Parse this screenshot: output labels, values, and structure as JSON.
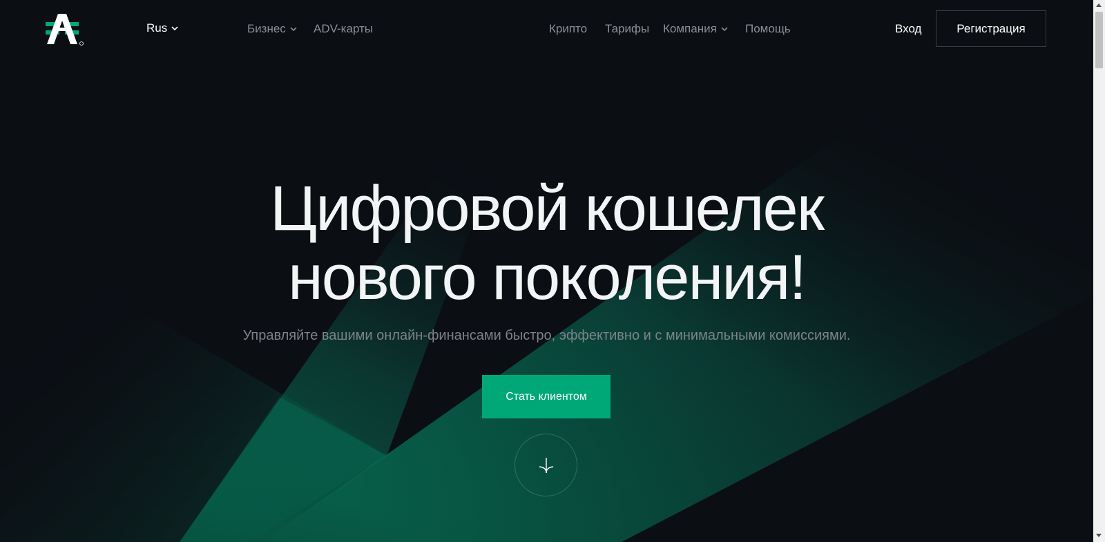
{
  "header": {
    "language": "Rus",
    "nav_left": [
      {
        "label": "Бизнес",
        "has_dropdown": true
      },
      {
        "label": "ADV-карты",
        "has_dropdown": false
      }
    ],
    "nav_right": [
      {
        "label": "Крипто",
        "has_dropdown": false
      },
      {
        "label": "Тарифы",
        "has_dropdown": false
      },
      {
        "label": "Компания",
        "has_dropdown": true
      },
      {
        "label": "Помощь",
        "has_dropdown": false
      }
    ],
    "login_label": "Вход",
    "register_label": "Регистрация"
  },
  "hero": {
    "title_line1": "Цифровой кошелек",
    "title_line2": "нового поколения!",
    "subtitle": "Управляйте вашими онлайн-финансами быстро, эффективно и с минимальными комиссиями.",
    "cta_label": "Стать клиентом"
  },
  "icons": {
    "logo": "advcash-logo",
    "scroll": "arrow-down-icon",
    "chevron": "chevron-down-icon"
  },
  "colors": {
    "background": "#0b0e13",
    "accent": "#00a878",
    "nav_text": "#8a8f96",
    "title_text": "#f2f4f5"
  }
}
